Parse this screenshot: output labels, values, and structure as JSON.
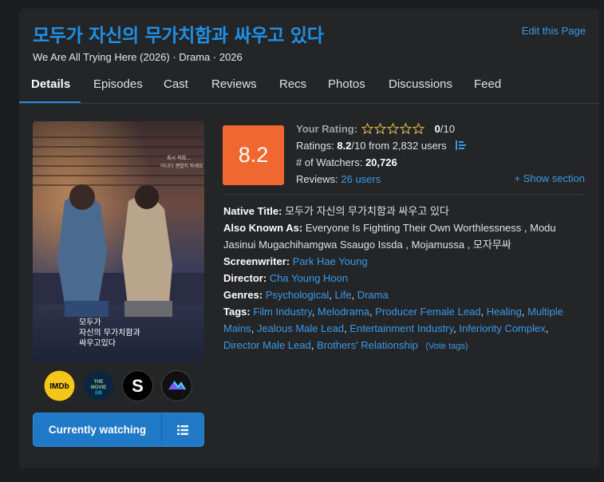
{
  "header": {
    "title": "모두가 자신의 무가치함과 싸우고 있다",
    "subtitle": "We Are All Trying Here (2026) · Drama · 2026",
    "edit_link": "Edit this Page"
  },
  "tabs": [
    {
      "label": "Details",
      "active": true
    },
    {
      "label": "Episodes"
    },
    {
      "label": "Cast"
    },
    {
      "label": "Reviews"
    },
    {
      "label": "Recs"
    },
    {
      "label": "Photos"
    },
    {
      "label": "Discussions"
    },
    {
      "label": "Feed"
    }
  ],
  "poster": {
    "lines": [
      "모두가",
      "자신의 무가치함과",
      "싸우고있다"
    ]
  },
  "services": [
    {
      "name": "imdb-icon",
      "label": "IMDb",
      "color": "#f5c518"
    },
    {
      "name": "tmdb-icon",
      "label": "THE MOVIE DB",
      "color": "#0d253f"
    },
    {
      "name": "simkl-icon",
      "label": "S",
      "color": "#000000"
    },
    {
      "name": "trakt-icon",
      "label": "",
      "color": "#111111"
    }
  ],
  "watch": {
    "label": "Currently watching"
  },
  "score": {
    "value": "8.2",
    "color": "#f0682f"
  },
  "rating": {
    "your_rating_label": "Your Rating:",
    "your_rating_value": "0",
    "your_rating_max": "/10",
    "ratings_label": "Ratings:",
    "ratings_value": "8.2",
    "ratings_rest": "/10 from 2,832 users",
    "watchers_label": "# of Watchers:",
    "watchers_value": "20,726",
    "reviews_label": "Reviews:",
    "reviews_value": "26 users",
    "stars_filled": 0,
    "stars_total": 10
  },
  "show_section": "+ Show section",
  "details": {
    "native_title_label": "Native Title:",
    "native_title": "모두가 자신의 무가치함과 싸우고 있다",
    "aka_label": "Also Known As:",
    "aka_1": "Everyone Is Fighting Their Own Worthlessness",
    "aka_2": "Modu Jasinui Mugachihamgwa Ssaugo Issda",
    "aka_3": "Mojamussa",
    "aka_4": "모자무싸",
    "screenwriter_label": "Screenwriter:",
    "screenwriter": "Park Hae Young",
    "director_label": "Director:",
    "director": "Cha Young Hoon",
    "genres_label": "Genres:",
    "genres": [
      "Psychological",
      "Life",
      "Drama"
    ],
    "tags_label": "Tags:",
    "tags": [
      "Film Industry",
      "Melodrama",
      "Producer Female Lead",
      "Healing",
      "Multiple Mains",
      "Jealous Male Lead",
      "Entertainment Industry",
      "Inferiority Complex",
      "Director Male Lead",
      "Brothers' Relationship"
    ],
    "vote_tags": "(Vote tags)"
  }
}
